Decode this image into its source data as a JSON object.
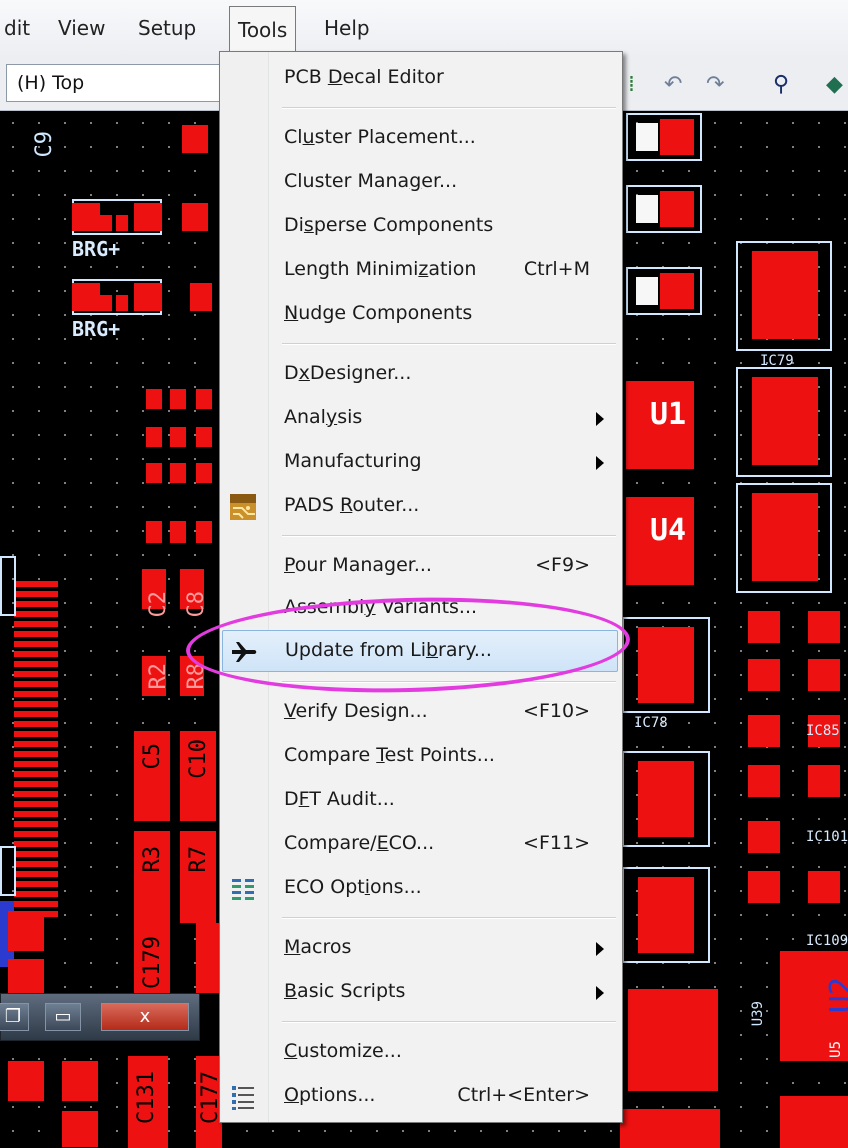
{
  "menubar": {
    "items": [
      "dit",
      "View",
      "Setup",
      "Tools",
      "Help"
    ],
    "active": "Tools"
  },
  "toolbar": {
    "layer_value": "(H) Top",
    "icons": [
      "route-icon",
      "undo-icon",
      "redo-icon",
      "zoom-icon",
      "layer-icon"
    ]
  },
  "pcb": {
    "labels": [
      "BRG+",
      "BRG+",
      "U1",
      "U4",
      "IC79",
      "IC78",
      "IC85",
      "IC101",
      "IC109",
      "U39"
    ],
    "vertical_labels": [
      "C9",
      "C5",
      "C10",
      "R3",
      "R7",
      "C179",
      "C131",
      "C177",
      "R2",
      "R8",
      "C2",
      "C8",
      "U2",
      "U5"
    ]
  },
  "window_buttons": [
    "restore",
    "maximize",
    "close"
  ],
  "window_close_label": "x",
  "tools_menu": {
    "items": [
      {
        "pre": "PCB ",
        "u": "D",
        "post": "ecal Editor",
        "shortcut": "",
        "submenu": false
      },
      {
        "pre": "Cl",
        "u": "u",
        "post": "ster Placement...",
        "shortcut": "",
        "submenu": false
      },
      {
        "pre": "Cluster Mana",
        "u": "g",
        "post": "er...",
        "shortcut": "",
        "submenu": false
      },
      {
        "pre": "Di",
        "u": "s",
        "post": "perse Components",
        "shortcut": "",
        "submenu": false
      },
      {
        "pre": "Length Minimi",
        "u": "z",
        "post": "ation",
        "shortcut": "Ctrl+M",
        "submenu": false
      },
      {
        "pre": "",
        "u": "N",
        "post": "udge Components",
        "shortcut": "",
        "submenu": false
      },
      {
        "pre": "D",
        "u": "x",
        "post": "Designer...",
        "shortcut": "",
        "submenu": false
      },
      {
        "pre": "Anal",
        "u": "y",
        "post": "sis",
        "shortcut": "",
        "submenu": true
      },
      {
        "pre": "Manufacturing",
        "u": "",
        "post": "",
        "shortcut": "",
        "submenu": true
      },
      {
        "pre": "PADS ",
        "u": "R",
        "post": "outer...",
        "shortcut": "",
        "submenu": false
      },
      {
        "pre": "",
        "u": "P",
        "post": "our Manager...",
        "shortcut": "<F9>",
        "submenu": false
      },
      {
        "pre": "Assembl",
        "u": "y",
        "post": " Variants...",
        "shortcut": "",
        "submenu": false
      },
      {
        "pre": "Update from Li",
        "u": "b",
        "post": "rary...",
        "shortcut": "",
        "submenu": false
      },
      {
        "pre": "",
        "u": "V",
        "post": "erify Design...",
        "shortcut": "<F10>",
        "submenu": false
      },
      {
        "pre": "Compare ",
        "u": "T",
        "post": "est Points...",
        "shortcut": "",
        "submenu": false
      },
      {
        "pre": "D",
        "u": "F",
        "post": "T Audit...",
        "shortcut": "",
        "submenu": false
      },
      {
        "pre": "Compare/",
        "u": "E",
        "post": "CO...",
        "shortcut": "<F11>",
        "submenu": false
      },
      {
        "pre": "ECO Opt",
        "u": "i",
        "post": "ons...",
        "shortcut": "",
        "submenu": false
      },
      {
        "pre": "",
        "u": "M",
        "post": "acros",
        "shortcut": "",
        "submenu": true
      },
      {
        "pre": "",
        "u": "B",
        "post": "asic Scripts",
        "shortcut": "",
        "submenu": true
      },
      {
        "pre": "",
        "u": "C",
        "post": "ustomize...",
        "shortcut": "",
        "submenu": false
      },
      {
        "pre": "",
        "u": "O",
        "post": "ptions...",
        "shortcut": "Ctrl+<Enter>",
        "submenu": false
      }
    ],
    "highlighted": "Update from Library..."
  },
  "colors": {
    "copper": "#ee1111",
    "silkscreen": "#cfe8ff",
    "highlight_circle": "#e23be0",
    "menu_highlight": "#cfe4f8"
  }
}
